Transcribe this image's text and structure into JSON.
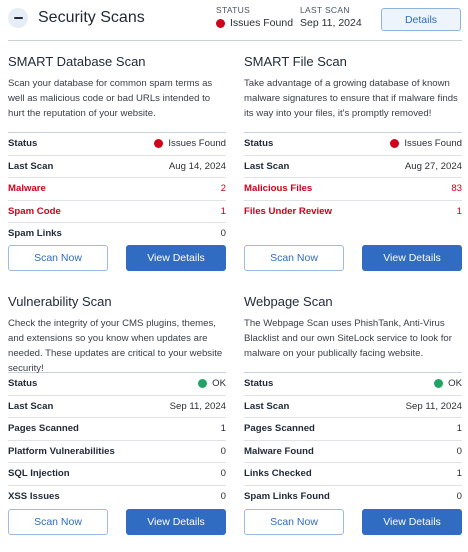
{
  "header": {
    "title": "Security Scans",
    "status_label": "STATUS",
    "status_value": "Issues Found",
    "status_color": "#d0021b",
    "last_scan_label": "LAST SCAN",
    "last_scan_value": "Sep 11, 2024",
    "details_label": "Details",
    "collapse_icon": "minus-icon"
  },
  "colors": {
    "accent": "#2f6cc2",
    "danger": "#d0021b",
    "ok": "#21a366"
  },
  "cards": [
    {
      "title": "SMART Database Scan",
      "description": "Scan your database for common spam terms as well as malicious code or bad URLs intended to hurt the reputation of your website.",
      "rows": [
        {
          "label": "Status",
          "value": "Issues Found",
          "status": "danger"
        },
        {
          "label": "Last Scan",
          "value": "Aug 14, 2024"
        },
        {
          "label": "Malware",
          "value": "2",
          "highlight": true
        },
        {
          "label": "Spam Code",
          "value": "1",
          "highlight": true
        },
        {
          "label": "Spam Links",
          "value": "0"
        }
      ],
      "scan_now": "Scan Now",
      "view_details": "View Details"
    },
    {
      "title": "SMART File Scan",
      "description": "Take advantage of a growing database of known malware signatures to ensure that if malware finds its way into your files, it's promptly removed!",
      "rows": [
        {
          "label": "Status",
          "value": "Issues Found",
          "status": "danger"
        },
        {
          "label": "Last Scan",
          "value": "Aug 27, 2024"
        },
        {
          "label": "Malicious Files",
          "value": "83",
          "highlight": true
        },
        {
          "label": "Files Under Review",
          "value": "1",
          "highlight": true
        }
      ],
      "scan_now": "Scan Now",
      "view_details": "View Details"
    },
    {
      "title": "Vulnerability Scan",
      "description": "Check the integrity of your CMS plugins, themes, and extensions so you know when updates are needed. These updates are critical to your website security!",
      "rows": [
        {
          "label": "Status",
          "value": "OK",
          "status": "ok"
        },
        {
          "label": "Last Scan",
          "value": "Sep 11, 2024"
        },
        {
          "label": "Pages Scanned",
          "value": "1"
        },
        {
          "label": "Platform Vulnerabilities",
          "value": "0"
        },
        {
          "label": "SQL Injection",
          "value": "0"
        },
        {
          "label": "XSS Issues",
          "value": "0"
        }
      ],
      "scan_now": "Scan Now",
      "view_details": "View Details"
    },
    {
      "title": "Webpage Scan",
      "description": "The Webpage Scan uses PhishTank, Anti-Virus Blacklist and our own SiteLock service to look for malware on your publically facing website.",
      "rows": [
        {
          "label": "Status",
          "value": "OK",
          "status": "ok"
        },
        {
          "label": "Last Scan",
          "value": "Sep 11, 2024"
        },
        {
          "label": "Pages Scanned",
          "value": "1"
        },
        {
          "label": "Malware Found",
          "value": "0"
        },
        {
          "label": "Links Checked",
          "value": "1"
        },
        {
          "label": "Spam Links Found",
          "value": "0"
        }
      ],
      "scan_now": "Scan Now",
      "view_details": "View Details"
    }
  ]
}
